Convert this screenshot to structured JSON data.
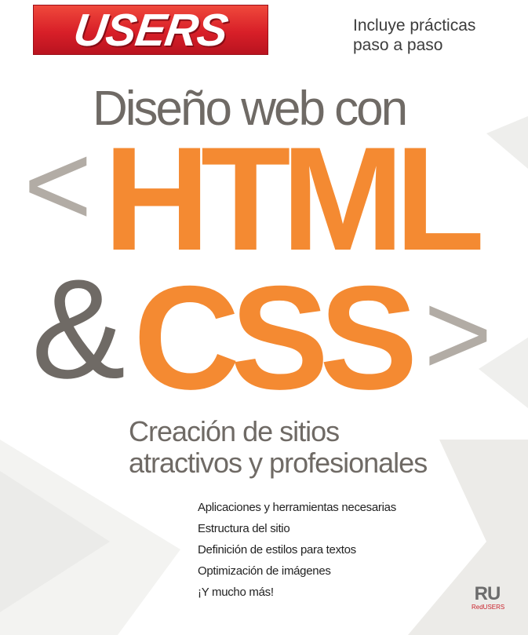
{
  "logo": {
    "text": "USERS"
  },
  "tagline": {
    "line1": "Incluye prácticas",
    "line2": "paso a paso"
  },
  "title": {
    "prefix": "Diseño web con",
    "bracket_open": "<",
    "word_html": "HTML",
    "ampersand": "&",
    "word_css": "CSS",
    "bracket_close": ">"
  },
  "headline": {
    "line1": "Creación de sitios",
    "line2": "atractivos y profesionales"
  },
  "features": [
    "Aplicaciones y herramientas necesarias",
    "Estructura del sitio",
    "Definición de estilos para textos",
    "Optimización de imágenes",
    "¡Y mucho más!"
  ],
  "brand": {
    "mark": "RU",
    "sub": "RedUSERS"
  },
  "colors": {
    "orange": "#f48a32",
    "gray_text": "#6f6a65",
    "light_gray": "#b2aca5",
    "logo_red": "#d81f28"
  }
}
